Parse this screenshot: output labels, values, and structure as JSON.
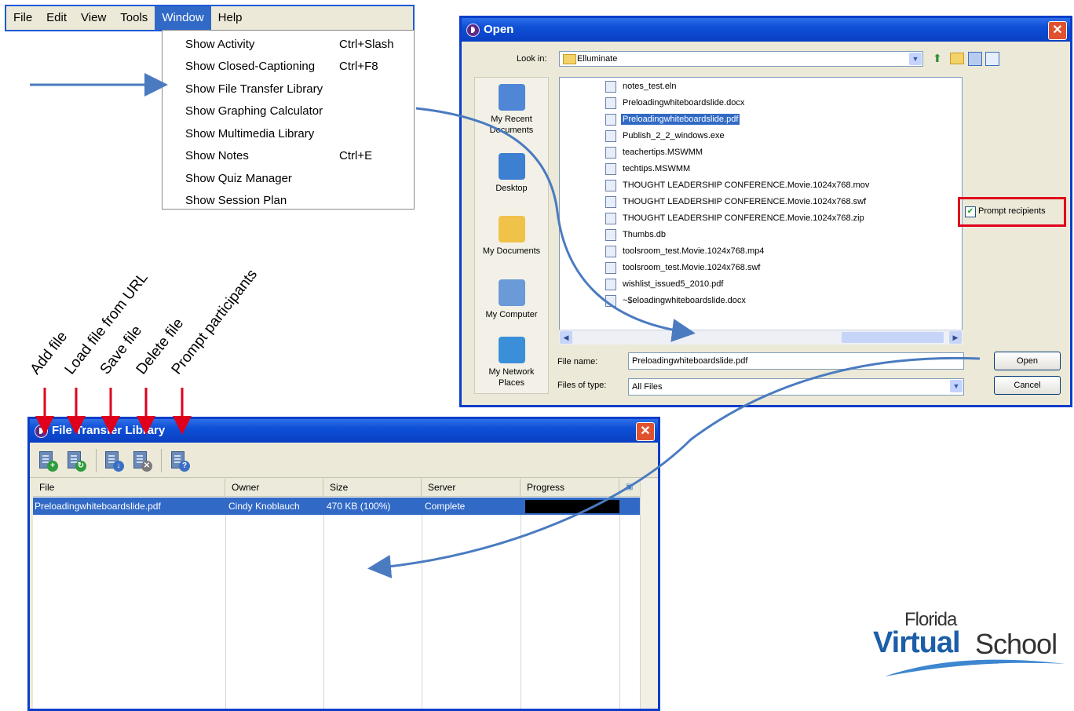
{
  "menubar": {
    "items": [
      "File",
      "Edit",
      "View",
      "Tools",
      "Window",
      "Help"
    ],
    "active": "Window"
  },
  "window_menu": {
    "items": [
      {
        "label": "Show Activity",
        "shortcut": "Ctrl+Slash"
      },
      {
        "label": "Show Closed-Captioning",
        "shortcut": "Ctrl+F8"
      },
      {
        "label": "Show File Transfer Library",
        "shortcut": ""
      },
      {
        "label": "Show Graphing Calculator",
        "shortcut": ""
      },
      {
        "label": "Show Multimedia Library",
        "shortcut": ""
      },
      {
        "label": "Show Notes",
        "shortcut": "Ctrl+E"
      },
      {
        "label": "Show Quiz Manager",
        "shortcut": ""
      },
      {
        "label": "Show Session Plan",
        "shortcut": ""
      }
    ]
  },
  "open_dialog": {
    "title": "Open",
    "look_in_label": "Look in:",
    "look_in_value": "Elluminate",
    "places": [
      {
        "label": "My Recent Documents",
        "icon": "recent-documents-icon",
        "color": "#4f86d6"
      },
      {
        "label": "Desktop",
        "icon": "desktop-icon",
        "color": "#3d7fd0"
      },
      {
        "label": "My Documents",
        "icon": "my-documents-icon",
        "color": "#f1c24a"
      },
      {
        "label": "My Computer",
        "icon": "my-computer-icon",
        "color": "#6a9ad8"
      },
      {
        "label": "My Network Places",
        "icon": "network-places-icon",
        "color": "#3b8fd9"
      }
    ],
    "files": [
      {
        "name": "notes_test.eln",
        "selected": false
      },
      {
        "name": "Preloadingwhiteboardslide.docx",
        "selected": false
      },
      {
        "name": "Preloadingwhiteboardslide.pdf",
        "selected": true
      },
      {
        "name": "Publish_2_2_windows.exe",
        "selected": false
      },
      {
        "name": "teachertips.MSWMM",
        "selected": false
      },
      {
        "name": "techtips.MSWMM",
        "selected": false
      },
      {
        "name": "THOUGHT LEADERSHIP CONFERENCE.Movie.1024x768.mov",
        "selected": false
      },
      {
        "name": "THOUGHT LEADERSHIP CONFERENCE.Movie.1024x768.swf",
        "selected": false
      },
      {
        "name": "THOUGHT LEADERSHIP CONFERENCE.Movie.1024x768.zip",
        "selected": false
      },
      {
        "name": "Thumbs.db",
        "selected": false
      },
      {
        "name": "toolsroom_test.Movie.1024x768.mp4",
        "selected": false
      },
      {
        "name": "toolsroom_test.Movie.1024x768.swf",
        "selected": false
      },
      {
        "name": "wishlist_issued5_2010.pdf",
        "selected": false
      },
      {
        "name": "~$eloadingwhiteboardslide.docx",
        "selected": false
      }
    ],
    "prompt_checkbox_label": "Prompt recipients",
    "prompt_checked": true,
    "file_name_label": "File name:",
    "file_name_value": "Preloadingwhiteboardslide.pdf",
    "file_type_label": "Files of type:",
    "file_type_value": "All Files",
    "open_button": "Open",
    "cancel_button": "Cancel"
  },
  "annotations": {
    "labels": [
      "Add file",
      "Load file from URL",
      "Save file",
      "Delete file",
      "Prompt participants"
    ],
    "highlight_color": "#e0001b",
    "arrow_color": "#4a7bc0"
  },
  "file_transfer_library": {
    "title": "File Transfer Library",
    "toolbar": [
      {
        "icon": "add-file-icon",
        "badge": "+",
        "badge_color": "#2f9b3c"
      },
      {
        "icon": "load-url-icon",
        "badge": "↻",
        "badge_color": "#2f9b3c"
      },
      {
        "icon": "save-file-icon",
        "badge": "↓",
        "badge_color": "#3a6fc4"
      },
      {
        "icon": "delete-file-icon",
        "badge": "✕",
        "badge_color": "#7a7a7a"
      },
      {
        "icon": "prompt-participants-icon",
        "badge": "?",
        "badge_color": "#3a6fc4"
      }
    ],
    "columns": [
      "File",
      "Owner",
      "Size",
      "Server",
      "Progress"
    ],
    "row": {
      "file": "Preloadingwhiteboardslide.pdf",
      "owner": "Cindy Knoblauch",
      "size": "470 KB (100%)",
      "server": "Complete",
      "progress": 1.0
    }
  },
  "logo": {
    "line1": "Florida",
    "line2a": "Virtual",
    "line2b": "School",
    "color": "#1c5ea8"
  }
}
